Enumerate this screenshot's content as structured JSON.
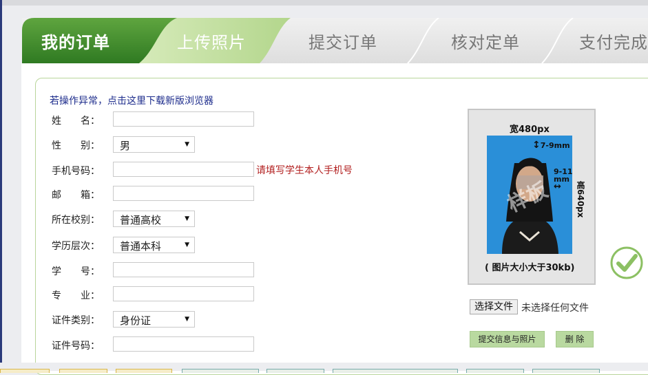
{
  "steps": [
    {
      "label": "我的订单",
      "state": "done"
    },
    {
      "label": "上传照片",
      "state": "current"
    },
    {
      "label": "提交订单",
      "state": "todo"
    },
    {
      "label": "核对定单",
      "state": "todo"
    },
    {
      "label": "支付完成",
      "state": "todo"
    }
  ],
  "notice": "若操作异常，点击这里下载新版浏览器",
  "form": {
    "name_label": "姓　　名：",
    "name_value": "",
    "gender_label": "性　　别：",
    "gender_value": "男",
    "phone_label": "手机号码：",
    "phone_value": "",
    "phone_hint": "请填写学生本人手机号",
    "email_label": "邮　　箱：",
    "email_value": "",
    "school_type_label": "所在校别：",
    "school_type_value": "普通高校",
    "edu_level_label": "学历层次：",
    "edu_level_value": "普通本科",
    "student_no_label": "学　　号：",
    "student_no_value": "",
    "major_label": "专　　业：",
    "major_value": "",
    "id_type_label": "证件类别：",
    "id_type_value": "身份证",
    "id_no_label": "证件号码：",
    "id_no_value": ""
  },
  "photo": {
    "width_text": "宽480px",
    "height_text": "高640px",
    "top_margin": "7-9mm",
    "side_margin_1": "9-11",
    "side_margin_2": "mm",
    "watermark": "样板",
    "caption": "( 图片大小大于30kb)"
  },
  "upload": {
    "choose_button": "选择文件",
    "no_file_text": "未选择任何文件",
    "submit_button": "提交信息与照片",
    "delete_button": "删 除"
  },
  "colors": {
    "step_done": "#3f8a2b",
    "step_current": "#c6e0a3",
    "step_todo": "#e3e3e3",
    "hint_red": "#b21f1f",
    "notice_blue": "#1d2c8c"
  }
}
